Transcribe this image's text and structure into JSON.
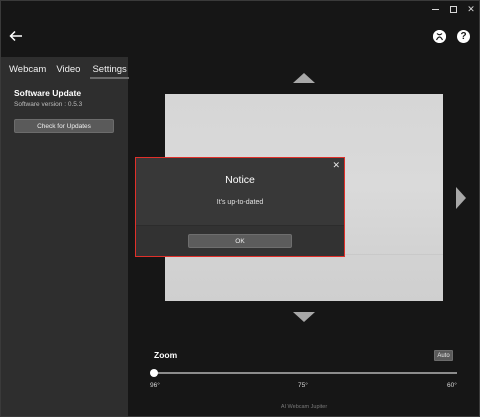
{
  "window": {
    "minimize_icon": "minimize-icon",
    "maximize_icon": "maximize-icon",
    "close_symbol": "✕"
  },
  "header": {
    "back_icon": "arrow-left-icon",
    "account_icon": "xbox-account-icon",
    "help_symbol": "?"
  },
  "sidebar": {
    "tabs": [
      {
        "label": "Webcam",
        "active": false
      },
      {
        "label": "Video",
        "active": false
      },
      {
        "label": "Settings",
        "active": true
      }
    ],
    "section_title": "Software Update",
    "version_text": "Software version : 0.5.3",
    "check_button_label": "Check for Updates"
  },
  "camera": {
    "up_arrow_icon": "triangle-up-icon",
    "down_arrow_icon": "triangle-down-icon",
    "right_arrow_icon": "triangle-right-icon"
  },
  "dialog": {
    "title": "Notice",
    "message": "It's up-to-dated",
    "ok_label": "OK",
    "close_symbol": "✕",
    "highlight_color": "#e0302a"
  },
  "zoom": {
    "label": "Zoom",
    "auto_label": "Auto",
    "ticks": [
      "96°",
      "75°",
      "60°"
    ],
    "slider_value_fraction": 0
  },
  "footer": {
    "text": "AI Webcam Jupiter"
  }
}
